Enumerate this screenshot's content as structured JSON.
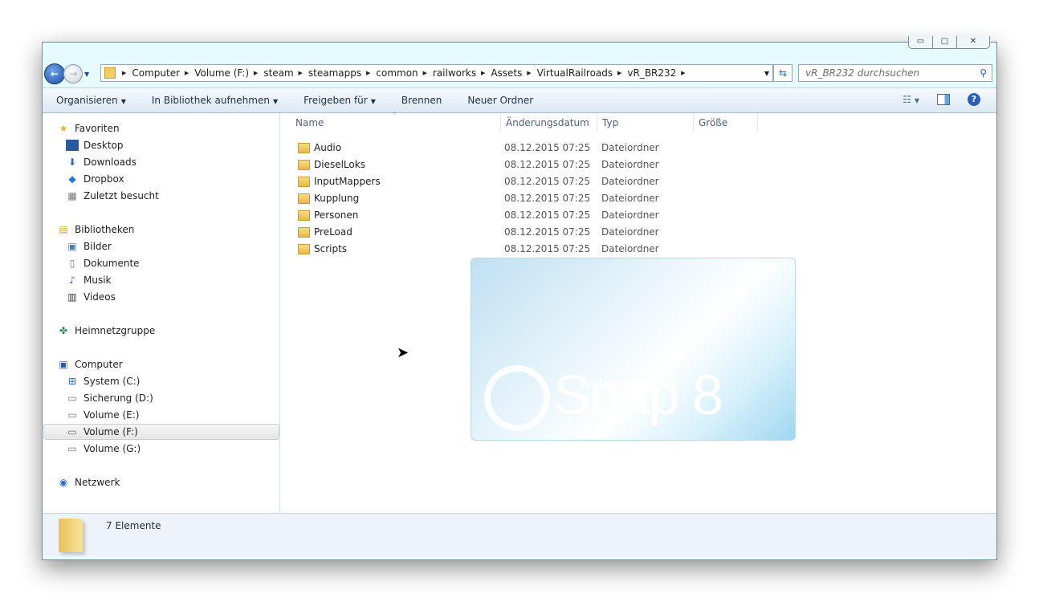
{
  "window": {
    "caption": {
      "minimize": "▭",
      "maximize": "□",
      "close": "✕"
    }
  },
  "address": {
    "crumbs": [
      "Computer",
      "Volume (F:)",
      "steam",
      "steamapps",
      "common",
      "railworks",
      "Assets",
      "VirtualRailroads",
      "vR_BR232"
    ]
  },
  "search": {
    "placeholder": "vR_BR232 durchsuchen"
  },
  "toolbar": {
    "organize": "Organisieren",
    "library": "In Bibliothek aufnehmen",
    "share": "Freigeben für",
    "burn": "Brennen",
    "new_folder": "Neuer Ordner"
  },
  "sidebar": {
    "favorites": {
      "label": "Favoriten",
      "items": [
        "Desktop",
        "Downloads",
        "Dropbox",
        "Zuletzt besucht"
      ]
    },
    "libraries": {
      "label": "Bibliotheken",
      "items": [
        "Bilder",
        "Dokumente",
        "Musik",
        "Videos"
      ]
    },
    "homegroup": {
      "label": "Heimnetzgruppe"
    },
    "computer": {
      "label": "Computer",
      "items": [
        "System (C:)",
        "Sicherung (D:)",
        "Volume (E:)",
        "Volume (F:)",
        "Volume (G:)"
      ]
    },
    "network": {
      "label": "Netzwerk"
    }
  },
  "columns": {
    "name": "Name",
    "date": "Änderungsdatum",
    "type": "Typ",
    "size": "Größe"
  },
  "files": [
    {
      "name": "Audio",
      "date": "08.12.2015 07:25",
      "type": "Dateiordner"
    },
    {
      "name": "DieselLoks",
      "date": "08.12.2015 07:25",
      "type": "Dateiordner"
    },
    {
      "name": "InputMappers",
      "date": "08.12.2015 07:25",
      "type": "Dateiordner"
    },
    {
      "name": "Kupplung",
      "date": "08.12.2015 07:25",
      "type": "Dateiordner"
    },
    {
      "name": "Personen",
      "date": "08.12.2015 07:25",
      "type": "Dateiordner"
    },
    {
      "name": "PreLoad",
      "date": "08.12.2015 07:25",
      "type": "Dateiordner"
    },
    {
      "name": "Scripts",
      "date": "08.12.2015 07:25",
      "type": "Dateiordner"
    }
  ],
  "status": {
    "count": "7 Elemente"
  },
  "splash": {
    "brand": "Ashampoo®",
    "product": "Snap 8"
  }
}
